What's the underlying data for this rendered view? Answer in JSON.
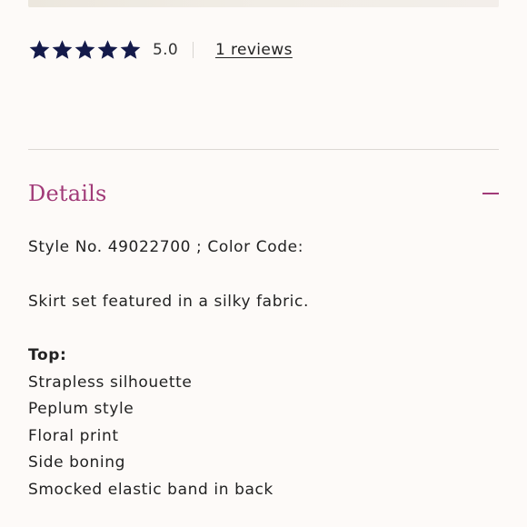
{
  "colors": {
    "accent": "#a13a78",
    "star": "#141a4a",
    "background": "#fdfaf8",
    "divider": "#dcd8d4"
  },
  "rating": {
    "stars_filled": 5,
    "stars_total": 5,
    "value": "5.0",
    "reviews_link": "1 reviews"
  },
  "details": {
    "title": "Details",
    "expanded_icon": "minus-icon",
    "style_line": "Style No. 49022700 ; Color Code:",
    "description": "Skirt set featured in a silky fabric.",
    "top_label": "Top:",
    "features": [
      "Strapless silhouette",
      "Peplum style",
      "Floral print",
      "Side boning",
      "Smocked elastic band in back"
    ]
  }
}
